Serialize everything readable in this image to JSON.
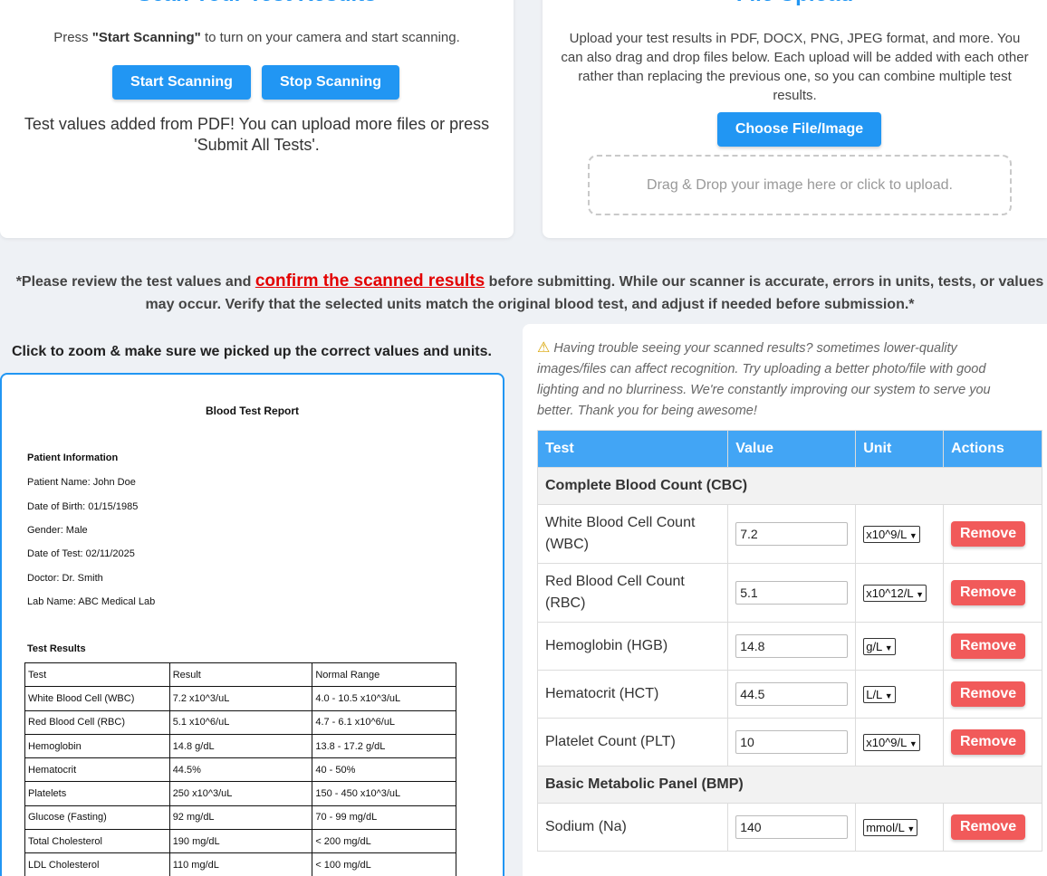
{
  "scan": {
    "title": "Scan Your Test Results",
    "intro_prefix": "Press ",
    "intro_bold": "\"Start Scanning\"",
    "intro_suffix": " to turn on your camera and start scanning.",
    "start_label": "Start Scanning",
    "stop_label": "Stop Scanning",
    "status_text": "Test values added from PDF! You can upload more files or press 'Submit All Tests'."
  },
  "upload": {
    "title": "File Upload",
    "description": "Upload your test results in PDF, DOCX, PNG, JPEG format, and more. You can also drag and drop files below. Each upload will be added with each other rather than replacing the previous one, so you can combine multiple test results.",
    "choose_label": "Choose File/Image",
    "dropzone_text": "Drag & Drop your image here or click to upload."
  },
  "warning": {
    "prefix": "*Please review the test values and ",
    "highlight": "confirm the scanned results",
    "suffix": " before submitting. While our scanner is accurate, errors in units, tests, or values may occur. Verify that the selected units match the original blood test, and adjust if needed before submission.*"
  },
  "preview": {
    "zoom_label": "Click to zoom & make sure we picked up the correct values and units.",
    "report_title": "Blood Test Report",
    "patient_heading": "Patient Information",
    "patient_lines": [
      "Patient Name: John Doe",
      "Date of Birth: 01/15/1985",
      "Gender: Male",
      "Date of Test: 02/11/2025",
      "Doctor: Dr. Smith",
      "Lab Name: ABC Medical Lab"
    ],
    "results_heading": "Test Results",
    "results_table": [
      [
        "Test",
        "Result",
        "Normal Range"
      ],
      [
        "White Blood Cell (WBC)",
        "7.2 x10^3/uL",
        "4.0 - 10.5 x10^3/uL"
      ],
      [
        "Red Blood Cell (RBC)",
        "5.1 x10^6/uL",
        "4.7 - 6.1 x10^6/uL"
      ],
      [
        "Hemoglobin",
        "14.8 g/dL",
        "13.8 - 17.2 g/dL"
      ],
      [
        "Hematocrit",
        "44.5%",
        "40 - 50%"
      ],
      [
        "Platelets",
        "250 x10^3/uL",
        "150 - 450 x10^3/uL"
      ],
      [
        "Glucose (Fasting)",
        "92 mg/dL",
        "70 - 99 mg/dL"
      ],
      [
        "Total Cholesterol",
        "190 mg/dL",
        "< 200 mg/dL"
      ],
      [
        "LDL Cholesterol",
        "110 mg/dL",
        "< 100 mg/dL"
      ]
    ]
  },
  "results": {
    "hint": "Having trouble seeing your scanned results? sometimes lower-quality images/files can affect recognition. Try uploading a better photo/file with good lighting and no blurriness. We're constantly improving our system to serve you better. Thank you for being awesome!",
    "hint_icon": "warning-icon",
    "headers": [
      "Test",
      "Value",
      "Unit",
      "Actions"
    ],
    "remove_label": "Remove",
    "groups": [
      {
        "name": "Complete Blood Count (CBC)",
        "rows": [
          {
            "test": "White Blood Cell Count (WBC)",
            "value": "7.2",
            "unit": "x10^9/L"
          },
          {
            "test": "Red Blood Cell Count (RBC)",
            "value": "5.1",
            "unit": "x10^12/L"
          },
          {
            "test": "Hemoglobin (HGB)",
            "value": "14.8",
            "unit": "g/L"
          },
          {
            "test": "Hematocrit (HCT)",
            "value": "44.5",
            "unit": "L/L"
          },
          {
            "test": "Platelet Count (PLT)",
            "value": "10",
            "unit": "x10^9/L"
          }
        ]
      },
      {
        "name": "Basic Metabolic Panel (BMP)",
        "rows": [
          {
            "test": "Sodium (Na)",
            "value": "140",
            "unit": "mmol/L"
          }
        ]
      }
    ]
  },
  "colors": {
    "accent": "#2196f3",
    "table_header": "#42a5f5",
    "remove": "#f15a5a",
    "highlight_red": "#e30000"
  }
}
